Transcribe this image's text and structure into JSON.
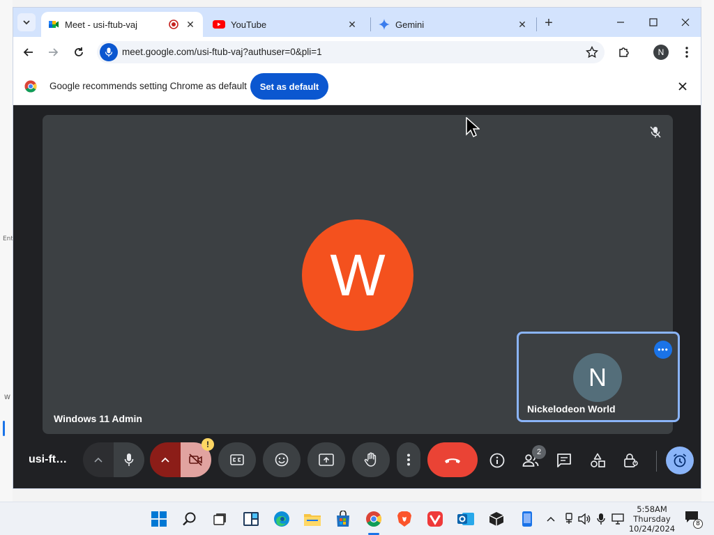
{
  "desktop": {
    "left_label_1": "Ent",
    "left_label_2": "W"
  },
  "tabs": [
    {
      "title": "Meet - usi-ftub-vaj",
      "active": true,
      "icon": "google-meet-icon",
      "recording": true
    },
    {
      "title": "YouTube",
      "active": false,
      "icon": "youtube-icon"
    },
    {
      "title": "Gemini",
      "active": false,
      "icon": "gemini-sparkle-icon"
    }
  ],
  "toolbar": {
    "url": "meet.google.com/usi-ftub-vaj?authuser=0&pli=1",
    "profile_initial": "N"
  },
  "infobar": {
    "message": "Google recommends setting Chrome as default",
    "button_label": "Set as default"
  },
  "meeting": {
    "main_participant_initial": "W",
    "main_participant_name": "Windows 11 Admin",
    "self_initial": "N",
    "self_name": "Nickelodeon World",
    "meeting_code_short": "usi-ft…",
    "people_count": "2",
    "camera_warning": "!"
  },
  "colors": {
    "main_avatar": "#f4511e",
    "self_avatar": "#546e7a",
    "tile": "#3c4043",
    "end_call": "#ea4335",
    "accent": "#8ab4f8"
  },
  "taskbar": {
    "time": "5:58AM",
    "day": "Thursday",
    "date": "10/24/2024",
    "notifications": "8"
  }
}
